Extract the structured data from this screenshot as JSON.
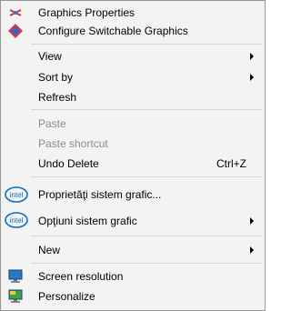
{
  "context_menu": {
    "items": [
      {
        "label": "Graphics Properties",
        "icon": "graphics-properties-icon"
      },
      {
        "label": "Configure Switchable Graphics",
        "icon": "switchable-graphics-icon"
      },
      {
        "label": "View",
        "submenu": true
      },
      {
        "label": "Sort by",
        "submenu": true
      },
      {
        "label": "Refresh"
      },
      {
        "label": "Paste",
        "disabled": true
      },
      {
        "label": "Paste shortcut",
        "disabled": true
      },
      {
        "label": "Undo Delete",
        "shortcut": "Ctrl+Z"
      },
      {
        "label": "Proprietăţi sistem grafic...",
        "icon": "intel-icon"
      },
      {
        "label": "Opţiuni sistem grafic",
        "icon": "intel-icon",
        "submenu": true
      },
      {
        "label": "New",
        "submenu": true
      },
      {
        "label": "Screen resolution",
        "icon": "screen-resolution-icon"
      },
      {
        "label": "Personalize",
        "icon": "personalize-icon"
      }
    ]
  }
}
